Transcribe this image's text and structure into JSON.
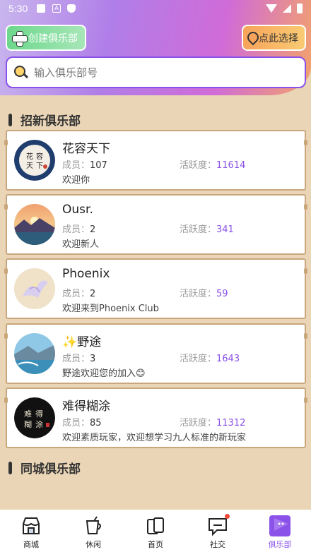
{
  "status": {
    "time": "5:30"
  },
  "header": {
    "create_label": "创建俱乐部",
    "pick_label": "点此选择"
  },
  "search": {
    "placeholder": "输入俱乐部号"
  },
  "sections": {
    "recruit": "招新俱乐部",
    "local": "同城俱乐部"
  },
  "labels": {
    "members": "成员：",
    "activity": "活跃度："
  },
  "clubs": [
    {
      "name": "花容天下",
      "members": "107",
      "activity": "11614",
      "desc": "欢迎你"
    },
    {
      "name": "Ousr.",
      "members": "2",
      "activity": "341",
      "desc": "欢迎新人"
    },
    {
      "name": "Phoenix",
      "members": "2",
      "activity": "59",
      "desc": "欢迎来到Phoenix Club"
    },
    {
      "name": "✨野途",
      "members": "3",
      "activity": "1643",
      "desc": "野途欢迎您的加入😊"
    },
    {
      "name": "难得糊涂",
      "members": "85",
      "activity": "11312",
      "desc": "欢迎素质玩家，欢迎想学习九人标准的新玩家"
    }
  ],
  "tabs": [
    {
      "label": "商城",
      "icon": "shop-icon"
    },
    {
      "label": "休闲",
      "icon": "cup-icon"
    },
    {
      "label": "首页",
      "icon": "card-icon"
    },
    {
      "label": "社交",
      "icon": "chat-icon"
    },
    {
      "label": "俱乐部",
      "icon": "flag-icon"
    }
  ],
  "colors": {
    "accent": "#8a52e8",
    "background": "#ead5b6",
    "card_border": "#c9a77d"
  }
}
